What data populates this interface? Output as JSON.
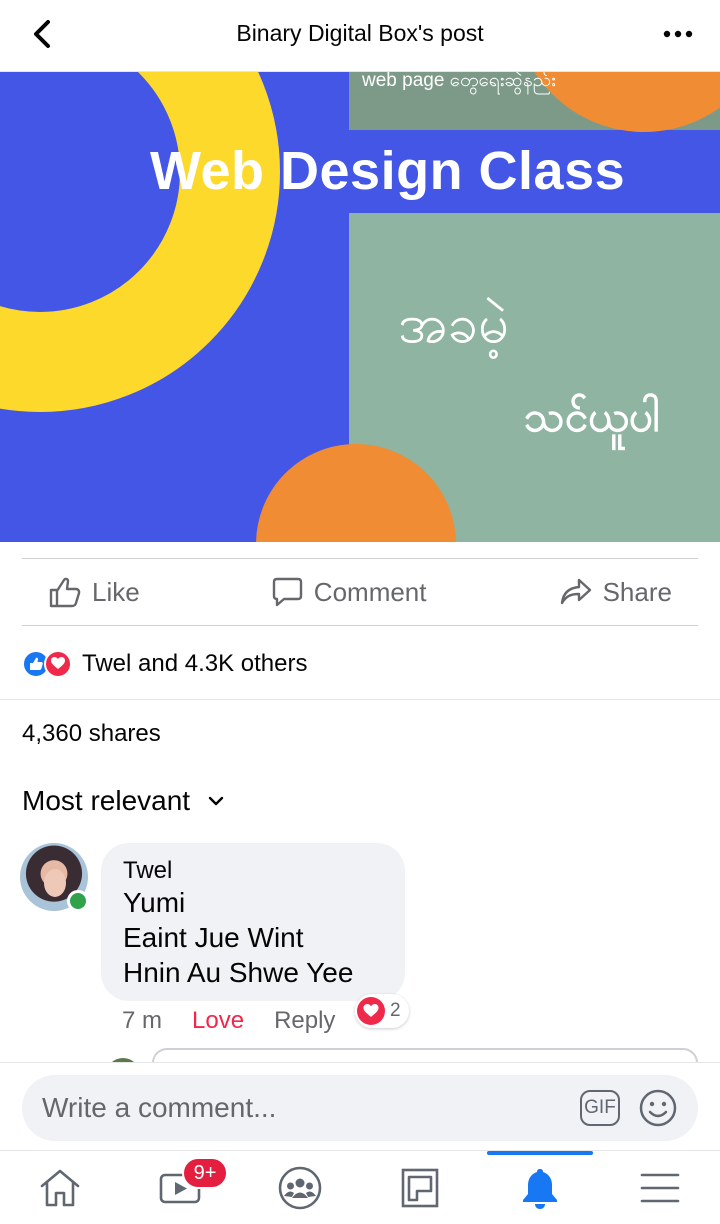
{
  "header": {
    "title": "Binary Digital Box's post",
    "back_icon": "chevron-left-icon",
    "more_icon": "more-horizontal-icon"
  },
  "banner": {
    "subtitle": "web page တွေရေးဆွဲနည်း",
    "title": "Web Design Class",
    "line1": "အခမဲ့",
    "line2": "သင်ယူပါ"
  },
  "actions": {
    "like": "Like",
    "comment": "Comment",
    "share": "Share"
  },
  "reactions": {
    "summary": "Twel and 4.3K others"
  },
  "shares": "4,360 shares",
  "sort": {
    "label": "Most relevant"
  },
  "comment": {
    "author": "Twel",
    "lines": [
      "Yumi",
      "Eaint Jue Wint",
      "Hnin Au Shwe Yee"
    ],
    "time": "7 m",
    "reaction_label": "Love",
    "reply_label": "Reply",
    "reaction_count": "2"
  },
  "composer": {
    "placeholder": "Write a comment...",
    "gif_label": "GIF"
  },
  "nav": {
    "video_badge": "9+",
    "active": "notifications"
  },
  "colors": {
    "brand_blue": "#1877f2",
    "love_red": "#f0284a",
    "banner_blue": "#4356e6",
    "banner_yellow": "#fcd92b",
    "banner_green": "#8fb4a1",
    "banner_orange": "#f08c33"
  }
}
